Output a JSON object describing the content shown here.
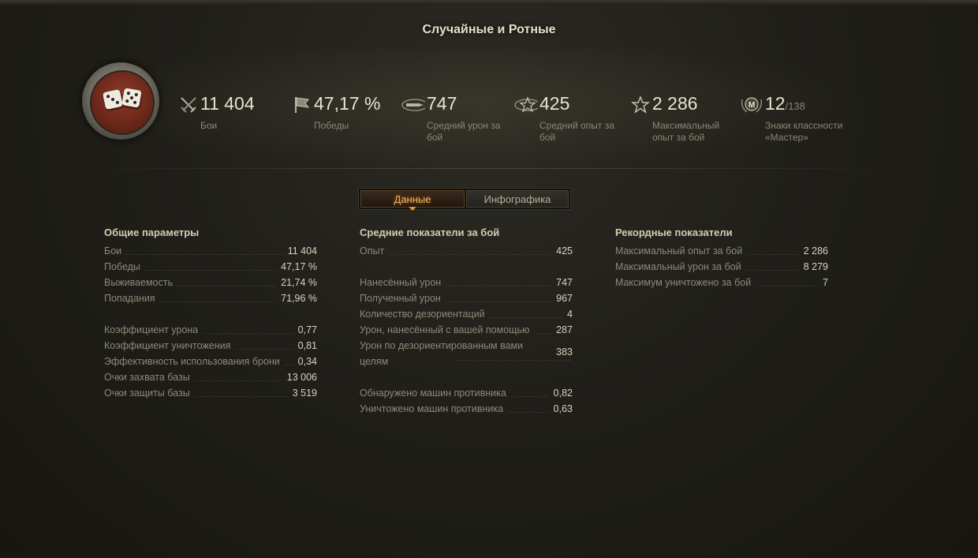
{
  "header": {
    "title": "Случайные и Ротные"
  },
  "stats": [
    {
      "icon": "crossed-swords-icon",
      "value": "11 404",
      "suffix": "",
      "label": "Бои"
    },
    {
      "icon": "flag-icon",
      "value": "47,17 %",
      "suffix": "",
      "label": "Победы"
    },
    {
      "icon": "damage-shell-icon",
      "value": "747",
      "suffix": "",
      "label": "Средний урон за бой"
    },
    {
      "icon": "star-xp-icon",
      "value": "425",
      "suffix": "",
      "label": "Средний опыт за бой"
    },
    {
      "icon": "star-max-xp-icon",
      "value": "2 286",
      "suffix": "",
      "label": "Максимальный опыт за бой"
    },
    {
      "icon": "mastery-badge-icon",
      "value": "12",
      "suffix": "/138",
      "label": "Знаки классности «Мастер»"
    }
  ],
  "tabs": {
    "data_label": "Данные",
    "infographic_label": "Инфографика"
  },
  "general": {
    "title": "Общие параметры",
    "rows": [
      {
        "label": "Бои",
        "value": "11 404"
      },
      {
        "label": "Победы",
        "value": "47,17 %"
      },
      {
        "label": "Выживаемость",
        "value": "21,74 %"
      },
      {
        "label": "Попадания",
        "value": "71,96 %"
      },
      {
        "label": "Коэффициент урона",
        "value": "0,77"
      },
      {
        "label": "Коэффициент уничтожения",
        "value": "0,81"
      },
      {
        "label": "Эффективность использования брони",
        "value": "0,34"
      },
      {
        "label": "Очки захвата базы",
        "value": "13 006"
      },
      {
        "label": "Очки защиты базы",
        "value": "3 519"
      }
    ]
  },
  "average": {
    "title": "Средние показатели за бой",
    "rows": [
      {
        "label": "Опыт",
        "value": "425"
      },
      {
        "label": "Нанесённый урон",
        "value": "747"
      },
      {
        "label": "Полученный урон",
        "value": "967"
      },
      {
        "label": "Количество дезориентаций",
        "value": "4"
      },
      {
        "label": "Урон, нанесённый с вашей помощью",
        "value": "287"
      },
      {
        "label": "Урон по дезориентированным вами целям",
        "value": "383"
      },
      {
        "label": "Обнаружено машин противника",
        "value": "0,82"
      },
      {
        "label": "Уничтожено машин противника",
        "value": "0,63"
      }
    ]
  },
  "records": {
    "title": "Рекордные показатели",
    "rows": [
      {
        "label": "Максимальный опыт за бой",
        "value": "2 286"
      },
      {
        "label": "Максимальный урон за бой",
        "value": "8 279"
      },
      {
        "label": "Максимум уничтожено за бой",
        "value": "7"
      }
    ]
  }
}
